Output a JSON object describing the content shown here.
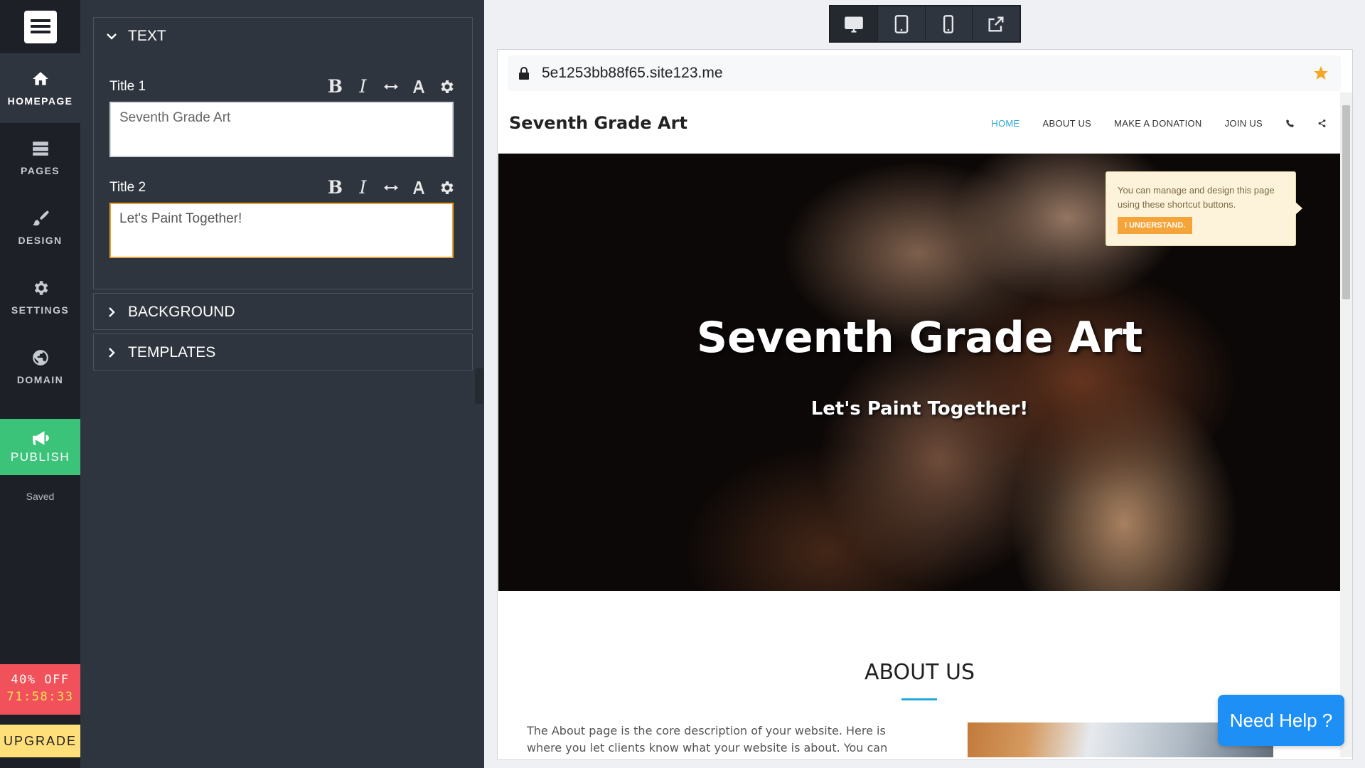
{
  "nav": {
    "items": [
      {
        "label": "HOMEPAGE",
        "icon": "home-icon"
      },
      {
        "label": "PAGES",
        "icon": "pages-icon"
      },
      {
        "label": "DESIGN",
        "icon": "brush-icon"
      },
      {
        "label": "SETTINGS",
        "icon": "gear-icon"
      },
      {
        "label": "DOMAIN",
        "icon": "globe-icon"
      }
    ],
    "publish_label": "PUBLISH",
    "saved_label": "Saved",
    "promo_discount": "40% OFF",
    "promo_timer": "71:58:33",
    "upgrade_label": "UPGRADE"
  },
  "panel": {
    "text_section": "TEXT",
    "title1_label": "Title 1",
    "title1_value": "Seventh Grade Art",
    "title2_label": "Title 2",
    "title2_value": "Let's Paint Together!",
    "background_section": "BACKGROUND",
    "templates_section": "TEMPLATES",
    "tools": {
      "bold": "B",
      "italic": "I"
    }
  },
  "preview": {
    "url": "5e1253bb88f65.site123.me",
    "site_brand": "Seventh Grade Art",
    "site_nav": [
      "HOME",
      "ABOUT US",
      "MAKE A DONATION",
      "JOIN US"
    ],
    "hero_title": "Seventh Grade Art",
    "hero_subtitle": "Let's Paint Together!",
    "tooltip_message": "You can manage and design this page using these shortcut buttons.",
    "tooltip_button": "I UNDERSTAND.",
    "about_heading": "ABOUT US",
    "about_body": "The About page is the core description of your website. Here is where you let clients know what your website is about. You can edit all of this"
  },
  "help_label": "Need Help ?",
  "colors": {
    "publish": "#3cc37a",
    "promo": "#f0515a",
    "upgrade": "#ffdf7a",
    "accent": "#26a9d8",
    "help": "#1e8ff5",
    "focus_border": "#f0a030"
  }
}
